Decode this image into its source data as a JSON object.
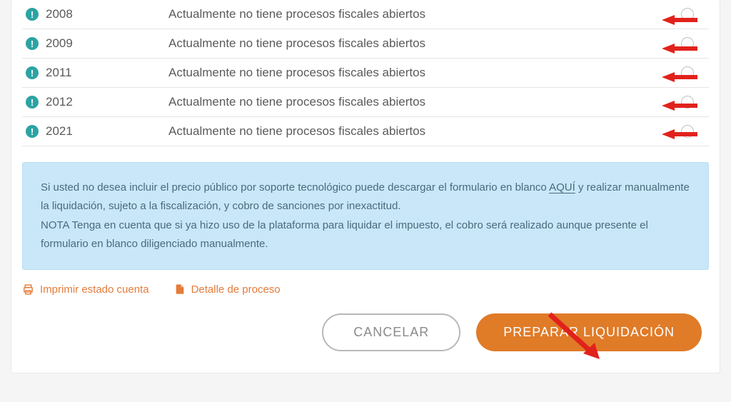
{
  "rows": [
    {
      "year": "2008",
      "status": "Actualmente no tiene procesos fiscales abiertos"
    },
    {
      "year": "2009",
      "status": "Actualmente no tiene procesos fiscales abiertos"
    },
    {
      "year": "2011",
      "status": "Actualmente no tiene procesos fiscales abiertos"
    },
    {
      "year": "2012",
      "status": "Actualmente no tiene procesos fiscales abiertos"
    },
    {
      "year": "2021",
      "status": "Actualmente no tiene procesos fiscales abiertos"
    }
  ],
  "notice": {
    "part1": "Si usted no desea incluir el precio público por soporte tecnológico puede descargar el formulario en blanco ",
    "link": "AQUÍ",
    "part2": " y realizar manualmente la liquidación, sujeto a la fiscalización, y cobro de sanciones por inexactitud.",
    "nota_label": "NOTA",
    "nota_text": " Tenga en cuenta que si ya hizo uso de la plataforma para liquidar el impuesto, el cobro será realizado aunque presente el formulario en blanco diligenciado manualmente."
  },
  "links": {
    "print": "Imprimir estado cuenta",
    "detail": "Detalle de proceso"
  },
  "buttons": {
    "cancel": "CANCELAR",
    "prepare": "PREPARAR LIQUIDACIÓN"
  }
}
